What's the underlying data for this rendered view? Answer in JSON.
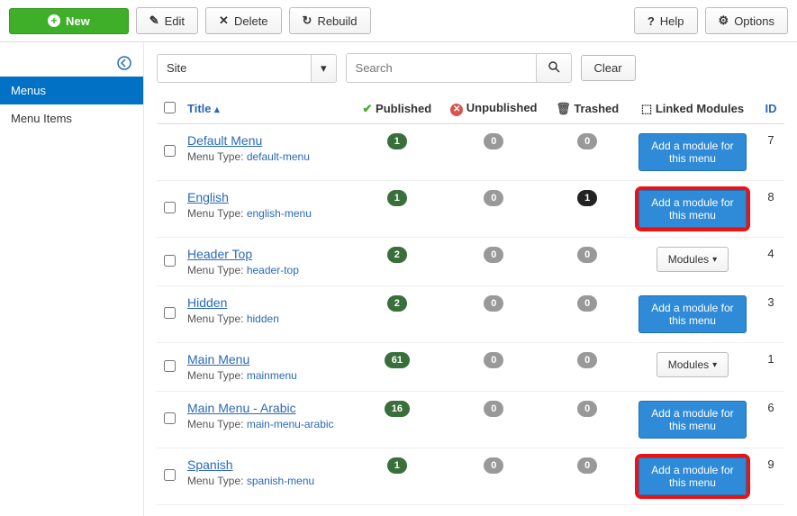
{
  "toolbar": {
    "new": "New",
    "edit": "Edit",
    "delete": "Delete",
    "rebuild": "Rebuild",
    "help": "Help",
    "options": "Options"
  },
  "sidebar": {
    "items": [
      {
        "label": "Menus",
        "active": true
      },
      {
        "label": "Menu Items",
        "active": false
      }
    ]
  },
  "filters": {
    "scope": "Site",
    "search_placeholder": "Search",
    "clear": "Clear"
  },
  "columns": {
    "title": "Title",
    "published": "Published",
    "unpublished": "Unpublished",
    "trashed": "Trashed",
    "linked_modules": "Linked Modules",
    "id": "ID"
  },
  "strings": {
    "menu_type_prefix": "Menu Type:",
    "add_module": "Add a module for this menu",
    "modules_btn": "Modules"
  },
  "rows": [
    {
      "title": "Default Menu",
      "menu_type": "default-menu",
      "published": 1,
      "unpublished": 0,
      "trashed": 0,
      "trashed_style": "gray",
      "module": "add",
      "highlight": false,
      "id": 7
    },
    {
      "title": "English",
      "menu_type": "english-menu",
      "published": 1,
      "unpublished": 0,
      "trashed": 1,
      "trashed_style": "dark",
      "module": "add",
      "highlight": true,
      "id": 8
    },
    {
      "title": "Header Top",
      "menu_type": "header-top",
      "published": 2,
      "unpublished": 0,
      "trashed": 0,
      "trashed_style": "gray",
      "module": "dropdown",
      "highlight": false,
      "id": 4
    },
    {
      "title": "Hidden",
      "menu_type": "hidden",
      "published": 2,
      "unpublished": 0,
      "trashed": 0,
      "trashed_style": "gray",
      "module": "add",
      "highlight": false,
      "id": 3
    },
    {
      "title": "Main Menu",
      "menu_type": "mainmenu",
      "published": 61,
      "unpublished": 0,
      "trashed": 0,
      "trashed_style": "gray",
      "module": "dropdown",
      "highlight": false,
      "id": 1
    },
    {
      "title": "Main Menu - Arabic",
      "menu_type": "main-menu-arabic",
      "published": 16,
      "unpublished": 0,
      "trashed": 0,
      "trashed_style": "gray",
      "module": "add",
      "highlight": false,
      "id": 6
    },
    {
      "title": "Spanish",
      "menu_type": "spanish-menu",
      "published": 1,
      "unpublished": 0,
      "trashed": 0,
      "trashed_style": "gray",
      "module": "add",
      "highlight": true,
      "id": 9
    }
  ]
}
